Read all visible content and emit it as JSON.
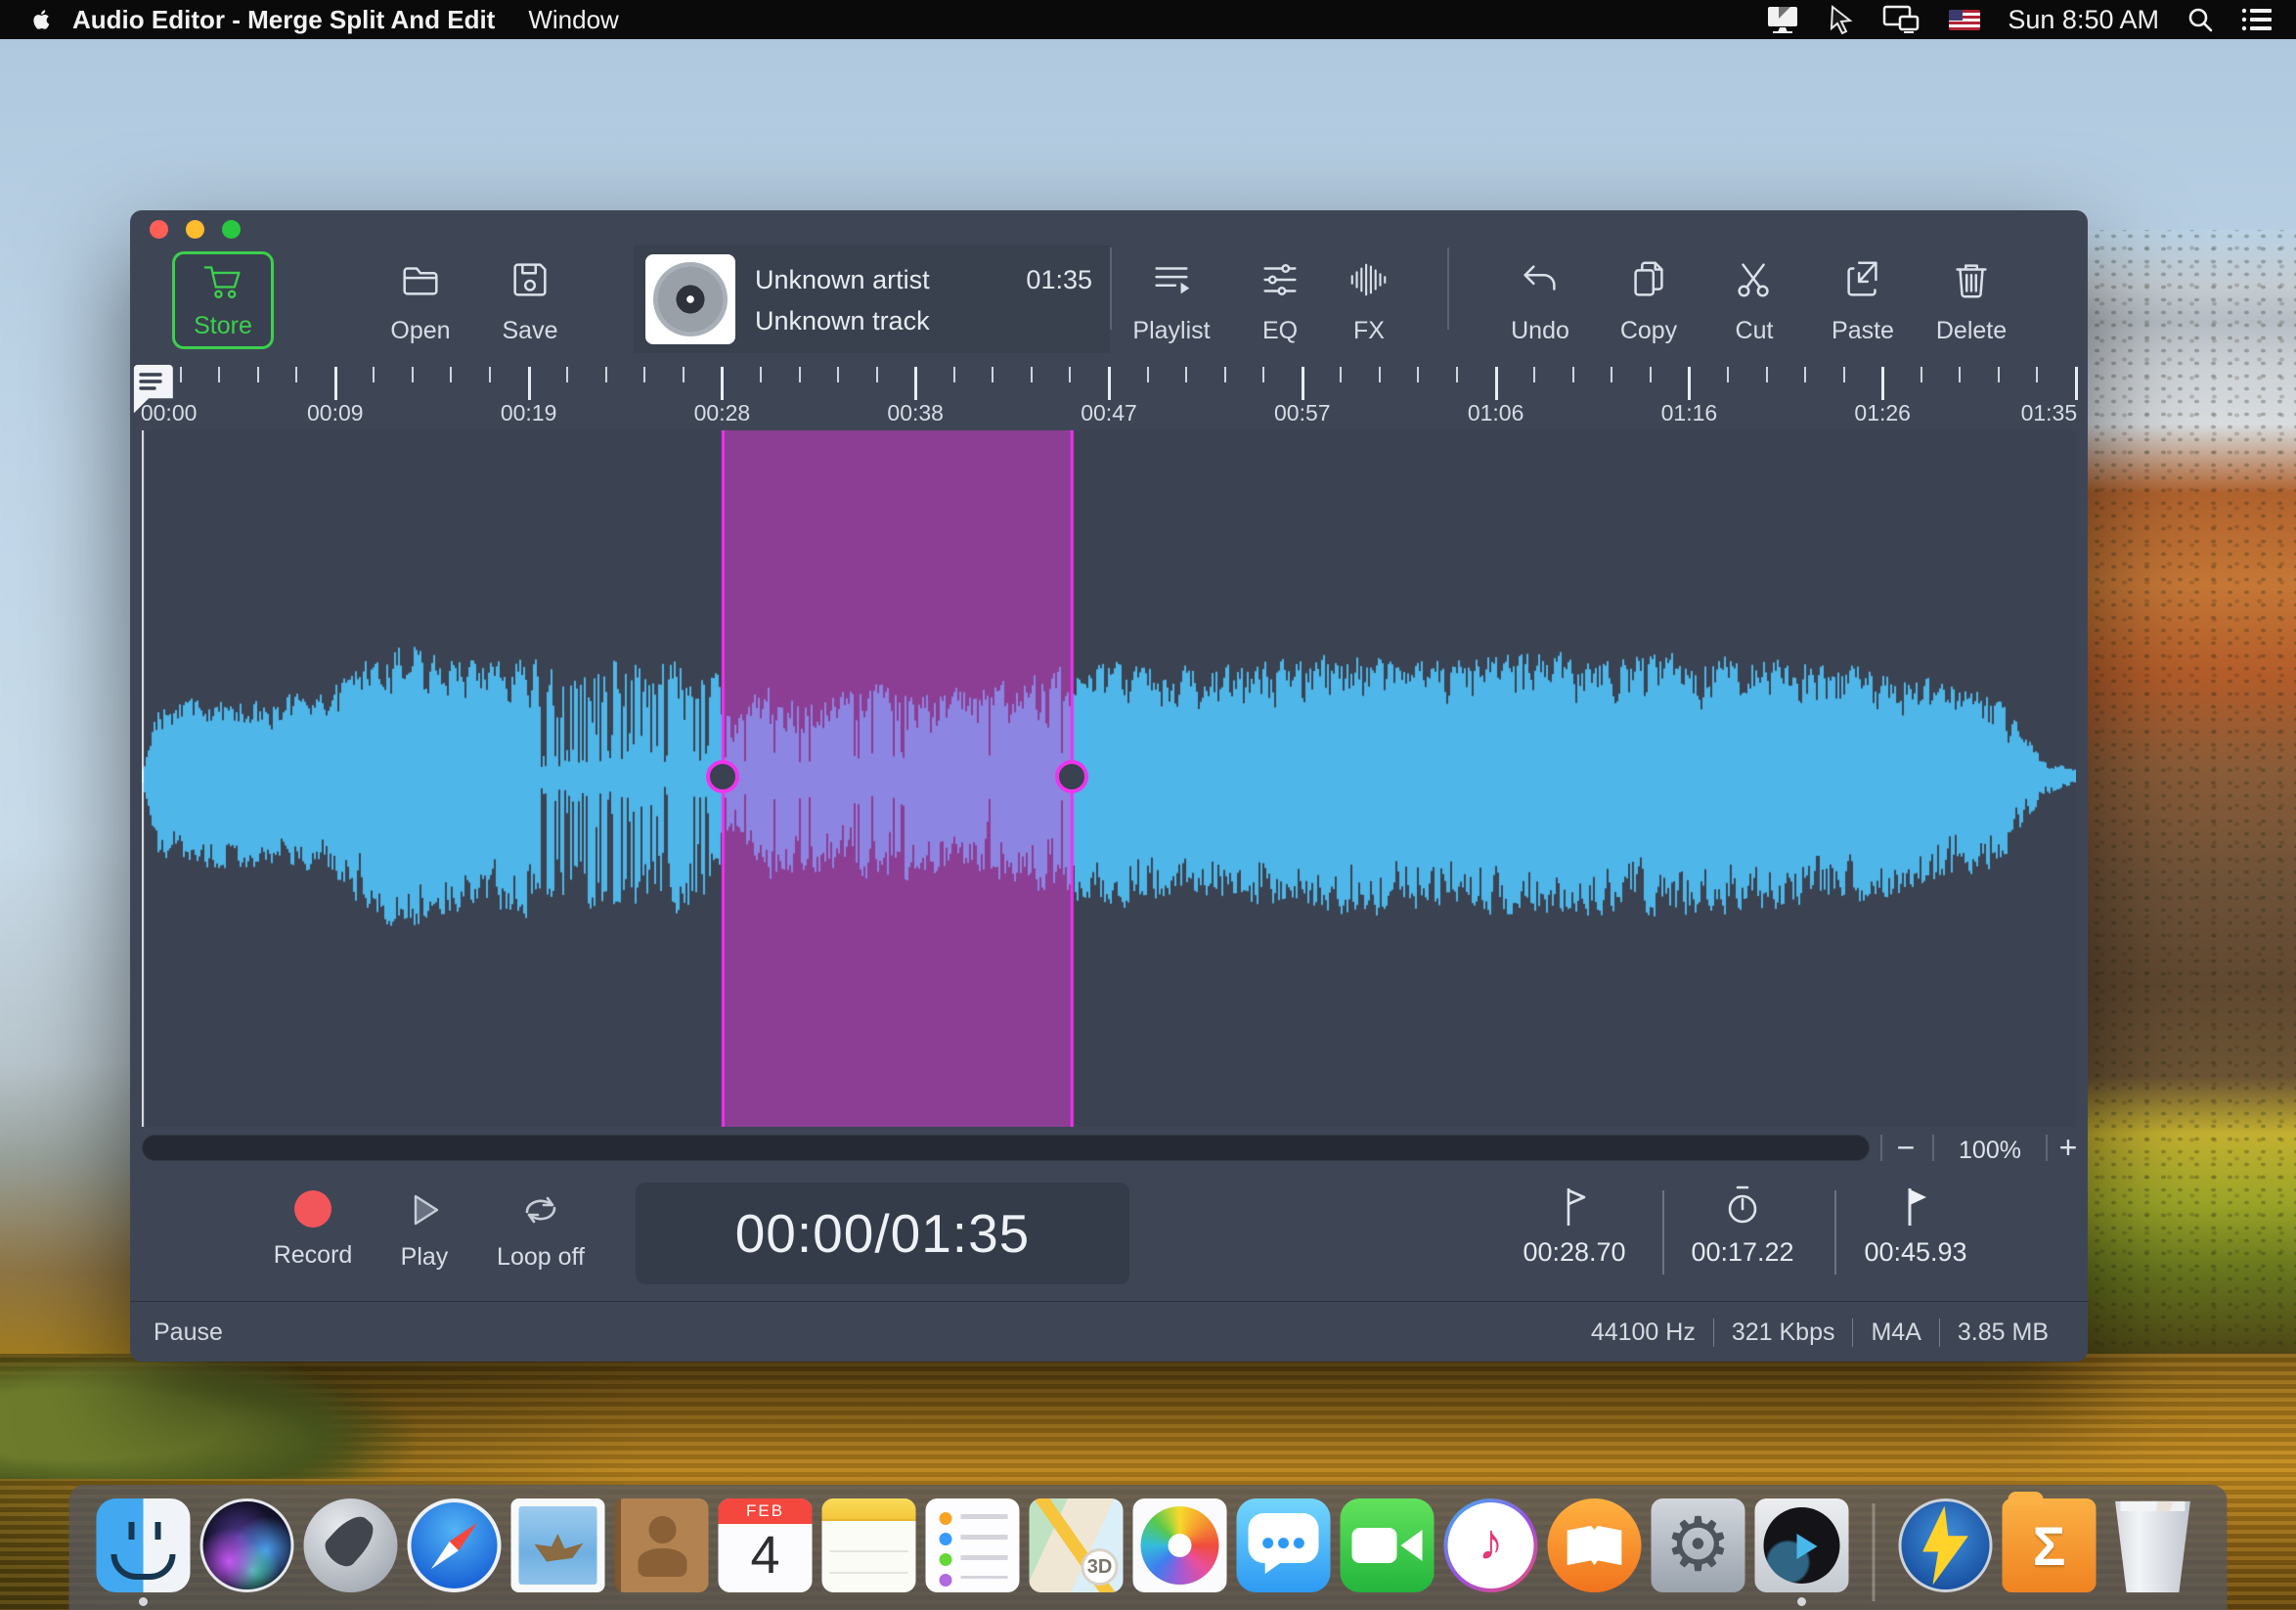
{
  "menu_bar": {
    "apple_icon": "apple-logo",
    "app_name": "Audio Editor - Merge Split And Edit",
    "menus": [
      "Window"
    ],
    "status_icons": [
      "display-mirroring-icon",
      "cursor-icon",
      "dual-displays-icon",
      "us-flag-icon"
    ],
    "clock": "Sun 8:50 AM",
    "search_icon": "magnifier-icon",
    "notification_icon": "notification-list-icon"
  },
  "window": {
    "toolbar": {
      "store": "Store",
      "open": "Open",
      "save": "Save",
      "artist": "Unknown artist",
      "track": "Unknown track",
      "duration": "01:35",
      "playlist": "Playlist",
      "eq": "EQ",
      "fx": "FX",
      "undo": "Undo",
      "copy": "Copy",
      "cut": "Cut",
      "paste": "Paste",
      "delete": "Delete"
    },
    "ruler": {
      "labels": [
        "00:00",
        "00:09",
        "00:19",
        "00:28",
        "00:38",
        "00:47",
        "00:57",
        "01:06",
        "01:16",
        "01:26",
        "01:35"
      ]
    },
    "zoom_bar": {
      "minus": "−",
      "level": "100%",
      "plus": "+"
    },
    "transport": {
      "record": "Record",
      "play": "Play",
      "loop": "Loop off",
      "time_display": "00:00/01:35",
      "markers": [
        {
          "icon": "flag-outline-icon",
          "value": "00:28.70"
        },
        {
          "icon": "stopwatch-icon",
          "value": "00:17.22"
        },
        {
          "icon": "flag-filled-icon",
          "value": "00:45.93"
        }
      ]
    },
    "status_bar": {
      "state": "Pause",
      "items": [
        "44100 Hz",
        "321 Kbps",
        "M4A",
        "3.85 MB"
      ]
    },
    "waveform": {
      "duration_seconds": 95.5,
      "selection": {
        "start_seconds": 28.7,
        "end_seconds": 45.93
      },
      "colors": {
        "wave": "#4eb6e8",
        "background": "#3b4251",
        "selection_fill": "#8b3e93",
        "selection_wave": "#8d85e2",
        "selection_border": "#f331f3",
        "handle_fill": "#3a4150"
      },
      "envelope": [
        [
          0,
          0.05
        ],
        [
          0.8,
          0.5
        ],
        [
          3,
          0.58
        ],
        [
          6,
          0.55
        ],
        [
          9,
          0.6
        ],
        [
          11,
          0.8
        ],
        [
          13,
          0.95
        ],
        [
          15,
          0.85
        ],
        [
          17,
          0.8
        ],
        [
          19,
          0.85
        ],
        [
          21,
          0.75
        ],
        [
          23,
          0.85
        ],
        [
          25,
          0.8
        ],
        [
          27,
          0.85
        ],
        [
          28.5,
          0.7
        ],
        [
          29.3,
          0.4
        ],
        [
          30.5,
          0.65
        ],
        [
          33,
          0.6
        ],
        [
          36,
          0.65
        ],
        [
          39,
          0.6
        ],
        [
          42,
          0.65
        ],
        [
          44.5,
          0.72
        ],
        [
          46,
          0.78
        ],
        [
          48,
          0.8
        ],
        [
          52,
          0.75
        ],
        [
          56,
          0.8
        ],
        [
          60,
          0.85
        ],
        [
          64,
          0.82
        ],
        [
          68,
          0.86
        ],
        [
          72,
          0.83
        ],
        [
          76,
          0.86
        ],
        [
          80,
          0.82
        ],
        [
          84,
          0.78
        ],
        [
          87,
          0.73
        ],
        [
          89.5,
          0.65
        ],
        [
          91.5,
          0.55
        ],
        [
          93,
          0.3
        ],
        [
          93.8,
          0.12
        ],
        [
          95.5,
          0.05
        ]
      ]
    },
    "accent_colors": {
      "store_green": "#3bd04c",
      "record_red": "#f2555a"
    }
  },
  "glyphs": {
    "itunes_note": "♪",
    "settings_gear": "⚙"
  },
  "dock": {
    "items": [
      {
        "id": "finder",
        "name": "finder",
        "running": true
      },
      {
        "id": "siri",
        "name": "siri"
      },
      {
        "id": "launchpad",
        "name": "launchpad"
      },
      {
        "id": "safari",
        "name": "safari"
      },
      {
        "id": "mail",
        "name": "mail"
      },
      {
        "id": "contacts",
        "name": "contacts"
      },
      {
        "id": "calendar",
        "name": "calendar",
        "month": "FEB",
        "day": "4"
      },
      {
        "id": "notes",
        "name": "notes"
      },
      {
        "id": "reminders",
        "name": "reminders"
      },
      {
        "id": "maps",
        "name": "maps",
        "badge": "3D"
      },
      {
        "id": "photos",
        "name": "photos"
      },
      {
        "id": "messages",
        "name": "messages"
      },
      {
        "id": "facetime",
        "name": "facetime"
      },
      {
        "id": "itunes",
        "name": "itunes"
      },
      {
        "id": "ibooks",
        "name": "ibooks"
      },
      {
        "id": "settings",
        "name": "system-preferences"
      },
      {
        "id": "audioapp",
        "name": "audio-editor",
        "running": true
      },
      {
        "id": "separator",
        "name": "separator"
      },
      {
        "id": "flash",
        "name": "lightning-app"
      },
      {
        "id": "sigma",
        "name": "sigma-folder",
        "glyph": "Σ"
      },
      {
        "id": "trash",
        "name": "trash"
      }
    ]
  }
}
